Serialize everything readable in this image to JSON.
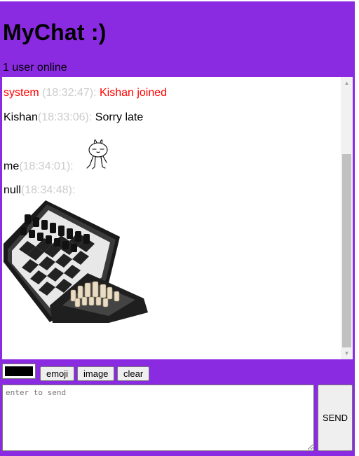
{
  "header": {
    "title": "MyChat :)",
    "online": "1 user online"
  },
  "messages": [
    {
      "sender": "system",
      "time": "(18:32:47):",
      "text": "Kishan joined",
      "kind": "system"
    },
    {
      "sender": "Kishan",
      "time": "(18:33:06):",
      "text": "Sorry late",
      "kind": "text"
    },
    {
      "sender": "me",
      "time": "(18:34:01):",
      "text": "",
      "kind": "sticker",
      "icon": "bunny-sticker-icon"
    },
    {
      "sender": "null",
      "time": "(18:34:48):",
      "text": "",
      "kind": "image",
      "icon": "chess-board-image"
    }
  ],
  "toolbar": {
    "color_value": "#000000",
    "emoji_label": "emoji",
    "image_label": "image",
    "clear_label": "clear"
  },
  "composer": {
    "placeholder": "enter to send",
    "value": "",
    "send_label": "SEND"
  },
  "colors": {
    "background": "#8a2be2",
    "system_text": "#ff0000",
    "timestamp": "#cccccc"
  }
}
